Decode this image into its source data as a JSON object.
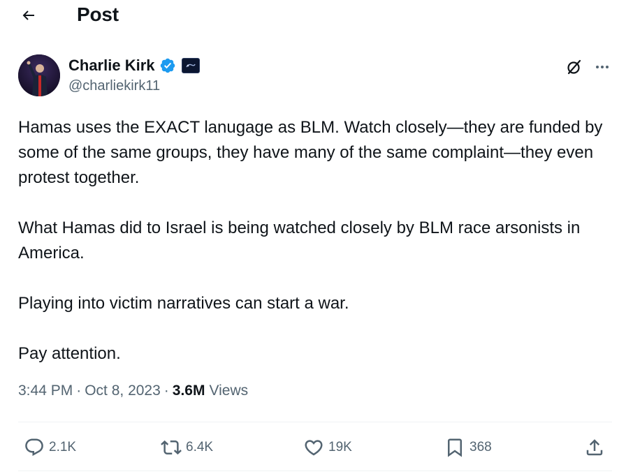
{
  "header": {
    "title": "Post"
  },
  "author": {
    "display_name": "Charlie Kirk",
    "handle": "@charliekirk11",
    "verified": true
  },
  "tweet": {
    "paragraphs": [
      "Hamas uses the EXACT lanugage as BLM. Watch closely—they are funded by some of the same groups, they have many of the same complaint—they even protest together.",
      "What Hamas did to Israel is being watched closely by BLM race arsonists in America.",
      "Playing into victim narratives can start a war.",
      "Pay attention."
    ]
  },
  "meta": {
    "time": "3:44 PM",
    "date": "Oct 8, 2023",
    "sep": "·",
    "views_count": "3.6M",
    "views_label": "Views"
  },
  "actions": {
    "replies": "2.1K",
    "reposts": "6.4K",
    "likes": "19K",
    "bookmarks": "368"
  },
  "icons": {
    "back": "arrow-left-icon",
    "verified": "verified-badge-icon",
    "affiliation": "affiliation-badge-icon",
    "grok": "grok-icon",
    "more": "more-icon",
    "reply": "reply-icon",
    "repost": "repost-icon",
    "like": "heart-icon",
    "bookmark": "bookmark-icon",
    "share": "share-icon"
  },
  "colors": {
    "text": "#0f1419",
    "secondary": "#536471",
    "verified": "#1d9bf0",
    "divider": "#eff3f4"
  }
}
